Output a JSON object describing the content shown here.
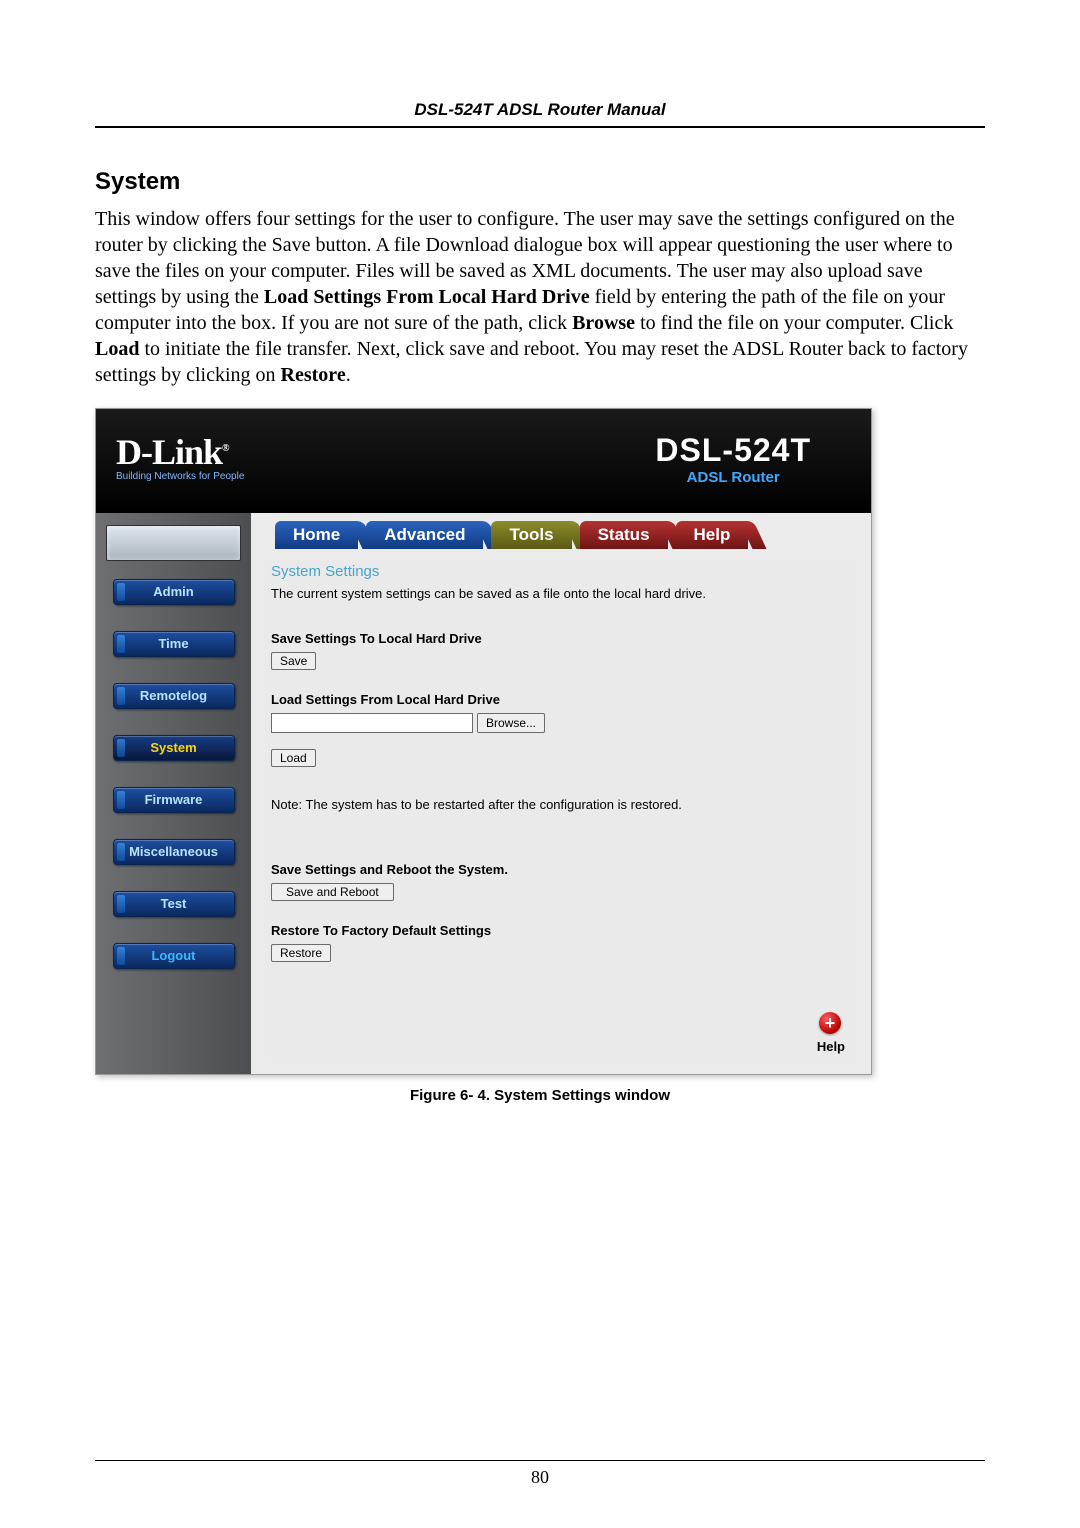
{
  "doc": {
    "running_head": "DSL-524T ADSL Router Manual",
    "section_title": "System",
    "body_chunks": {
      "p1a": "This window offers four settings for the user to configure. The user may save the settings configured on the router by clicking the Save button. A file Download dialogue box will appear questioning the user where to save the files on your computer. Files will be saved as XML documents. The user may also upload save settings by using the ",
      "b1": "Load Settings From Local Hard Drive",
      "p1b": " field by entering the path of the file on your computer into the box. If you are not sure of the path, click ",
      "b2": "Browse",
      "p1c": " to find the file on your computer. Click ",
      "b3": "Load",
      "p1d": " to initiate the file transfer. Next, click save and reboot. You may reset the ADSL Router back to factory settings by clicking on ",
      "b4": "Restore",
      "p1e": "."
    },
    "figure_caption": "Figure 6- 4. System Settings window",
    "page_number": "80"
  },
  "ui": {
    "logo": {
      "text": "D-Link",
      "reg": "®",
      "tagline": "Building Networks for People"
    },
    "model": {
      "name": "DSL-524T",
      "type": "ADSL Router"
    },
    "tabs": {
      "home": "Home",
      "advanced": "Advanced",
      "tools": "Tools",
      "status": "Status",
      "help": "Help"
    },
    "side": {
      "admin": "Admin",
      "time": "Time",
      "remotelog": "Remotelog",
      "system": "System",
      "firmware": "Firmware",
      "misc": "Miscellaneous",
      "test": "Test",
      "logout": "Logout"
    },
    "panel": {
      "title": "System Settings",
      "desc": "The current system settings can be saved as a file onto the local hard drive.",
      "save_h": "Save Settings To Local Hard Drive",
      "save_btn": "Save",
      "load_h": "Load Settings From Local Hard Drive",
      "browse_btn": "Browse...",
      "load_btn": "Load",
      "note": "Note: The system has to be restarted after the configuration is restored.",
      "reboot_h": "Save Settings and Reboot the System.",
      "reboot_btn": "Save and Reboot",
      "restore_h": "Restore To Factory Default Settings",
      "restore_btn": "Restore",
      "help_plus": "+",
      "help_label": "Help"
    }
  }
}
